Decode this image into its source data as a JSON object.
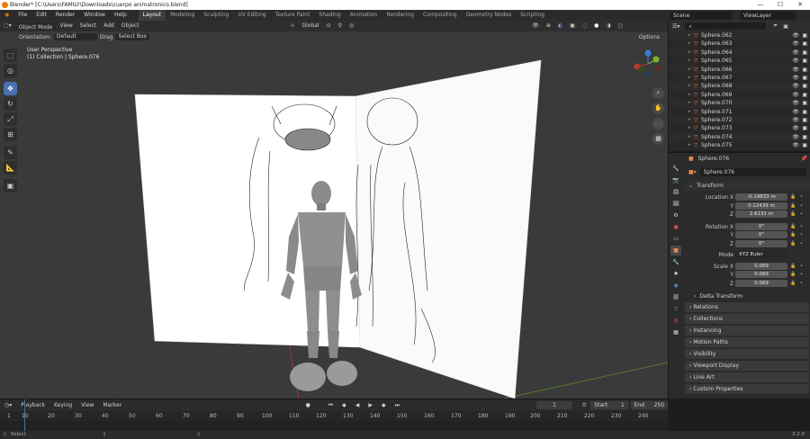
{
  "window": {
    "title": "Blender* [C:\\Users\\FAMILY\\Downloads\\cuerpo animatronico.blend]",
    "minimize": "—",
    "maximize": "☐",
    "close": "✕"
  },
  "menu": [
    "File",
    "Edit",
    "Render",
    "Window",
    "Help"
  ],
  "workspaces": [
    "Layout",
    "Modeling",
    "Sculpting",
    "UV Editing",
    "Texture Paint",
    "Shading",
    "Animation",
    "Rendering",
    "Compositing",
    "Geometry Nodes",
    "Scripting"
  ],
  "active_workspace": "Layout",
  "scene": {
    "scene_name": "Scene",
    "view_layer": "ViewLayer"
  },
  "viewport": {
    "mode": "Object Mode",
    "menus": [
      "View",
      "Select",
      "Add",
      "Object"
    ],
    "transform_orientation": "Global",
    "orientation_label": "Orientation:",
    "orientation_value": "Default",
    "drag_label": "Drag",
    "drag_value": "Select Box",
    "options_label": "Options",
    "view_name": "User Perspective",
    "collection_info": "(1) Collection | Sphere.076"
  },
  "gizmo": {
    "x": "X",
    "y": "Y",
    "z": "Z"
  },
  "outliner": {
    "items": [
      "Sphere.062",
      "Sphere.063",
      "Sphere.064",
      "Sphere.065",
      "Sphere.066",
      "Sphere.067",
      "Sphere.068",
      "Sphere.069",
      "Sphere.070",
      "Sphere.071",
      "Sphere.072",
      "Sphere.073",
      "Sphere.074",
      "Sphere.075"
    ]
  },
  "properties": {
    "object_name": "Sphere.076",
    "object_field": "Sphere.076",
    "transform_label": "Transform",
    "location": {
      "label": "Location X",
      "x": "-0.19833 m",
      "y": "0.12439 m",
      "z": "2.6131 m"
    },
    "rotation": {
      "label": "Rotation X",
      "x": "0°",
      "y": "0°",
      "z": "0°"
    },
    "mode_label": "Mode",
    "mode_value": "XYZ Euler",
    "scale": {
      "label": "Scale X",
      "x": "0.069",
      "y": "0.069",
      "z": "0.069"
    },
    "axis_y": "Y",
    "axis_z": "Z",
    "delta_transform": "Delta Transform",
    "panels": [
      "Relations",
      "Collections",
      "Instancing",
      "Motion Paths",
      "Visibility",
      "Viewport Display",
      "Line Art",
      "Custom Properties"
    ]
  },
  "timeline": {
    "menus": [
      "Playback",
      "Keying",
      "View",
      "Marker"
    ],
    "current_frame": "1",
    "start_label": "Start",
    "start": "1",
    "end_label": "End",
    "end": "250",
    "ticks": [
      "1",
      "10",
      "20",
      "30",
      "40",
      "50",
      "60",
      "70",
      "80",
      "90",
      "100",
      "110",
      "120",
      "130",
      "140",
      "150",
      "160",
      "170",
      "180",
      "190",
      "200",
      "210",
      "220",
      "230",
      "240"
    ]
  },
  "status": {
    "left": "Select",
    "version": "3.2.0"
  },
  "colors": {
    "accent": "#4772b3",
    "x_axis": "#c0392b",
    "y_axis": "#7bb32e",
    "z_axis": "#3b7dd8",
    "mesh_icon": "#e8884b"
  }
}
